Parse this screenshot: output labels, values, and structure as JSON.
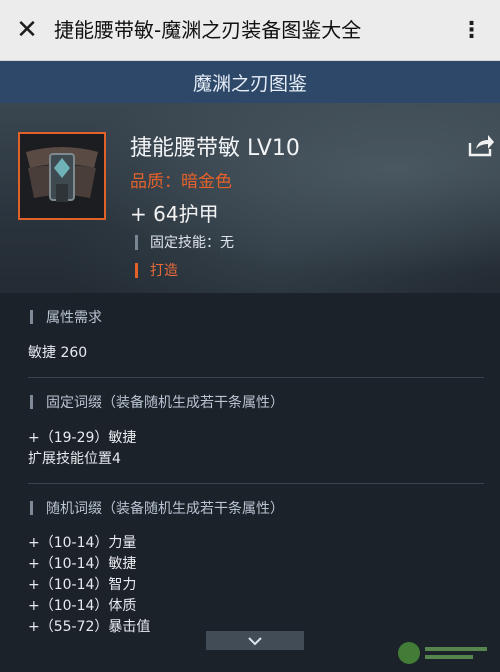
{
  "appbar": {
    "title": "捷能腰带敏-魔渊之刃装备图鉴大全",
    "close_icon": "close-icon",
    "more_icon": "more-icon"
  },
  "header": {
    "title": "魔渊之刃图鉴"
  },
  "item": {
    "name": "捷能腰带敏 LV10",
    "quality": "品质：暗金色",
    "armor": "+ 64护甲",
    "fixed_skill": "固定技能：无",
    "craft": "打造",
    "share_icon": "share-icon"
  },
  "sections": {
    "requirements": {
      "title": "属性需求",
      "lines": [
        "敏捷 260"
      ]
    },
    "fixed_affixes": {
      "title": "固定词缀（装备随机生成若干条属性）",
      "lines": [
        "+（19-29）敏捷",
        "扩展技能位置4"
      ]
    },
    "random_affixes": {
      "title": "随机词缀（装备随机生成若干条属性）",
      "lines": [
        "+（10-14）力量",
        "+（10-14）敏捷",
        "+（10-14）智力",
        "+（10-14）体质",
        "+（55-72）暴击值"
      ]
    }
  },
  "colors": {
    "header_bg": "#2d4869",
    "quality": "#e5612a",
    "frame": "#e1612b"
  }
}
